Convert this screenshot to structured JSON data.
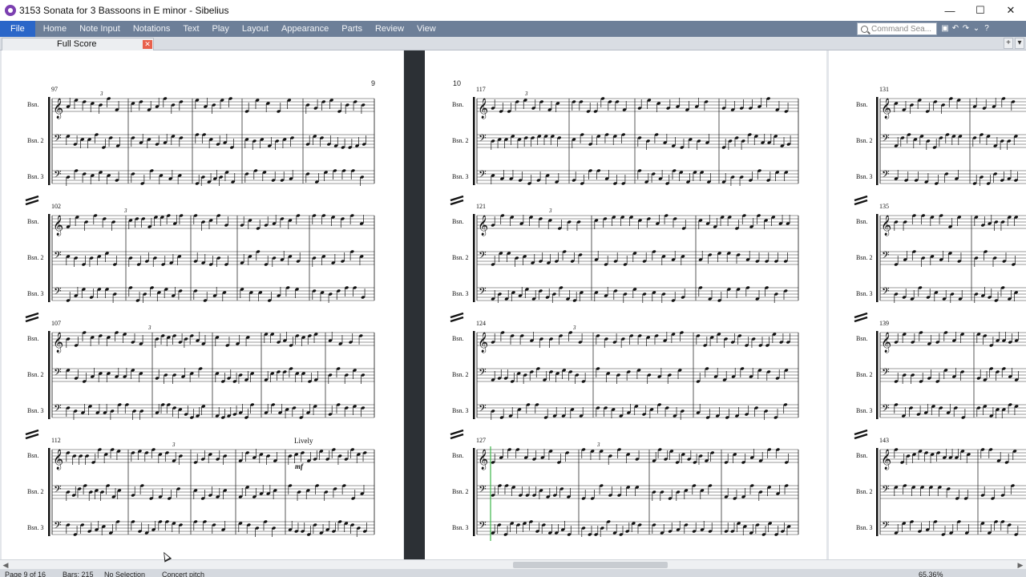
{
  "window": {
    "title": "3153 Sonata for 3 Bassoons in E minor - Sibelius",
    "controls": [
      "minimize",
      "maximize",
      "close"
    ]
  },
  "ribbon": {
    "tabs": [
      "File",
      "Home",
      "Note Input",
      "Notations",
      "Text",
      "Play",
      "Layout",
      "Appearance",
      "Parts",
      "Review",
      "View"
    ],
    "search_placeholder": "Command Sea..."
  },
  "document": {
    "tab_label": "Full Score"
  },
  "score": {
    "instrument_labels": [
      "Bsn.",
      "Bsn. 2",
      "Bsn. 3"
    ],
    "page_numbers": [
      "9",
      "10"
    ],
    "left_page_systems": [
      "97",
      "102",
      "107",
      "112"
    ],
    "right_page_systems": [
      "117",
      "121",
      "124",
      "127"
    ],
    "far_page_systems": [
      "131",
      "135",
      "139",
      "143"
    ],
    "tempo_marking": "Lively",
    "dynamic": "mf",
    "tuplet": "3"
  },
  "status": {
    "page": "Page 9 of 16",
    "bars": "Bars: 215",
    "selection": "No Selection",
    "pitch": "Concert pitch",
    "zoom": "65.36%"
  },
  "colors": {
    "ribbon": "#6d7f98",
    "file_tab": "#2a66c8",
    "playback_line": "#3bb54a"
  }
}
